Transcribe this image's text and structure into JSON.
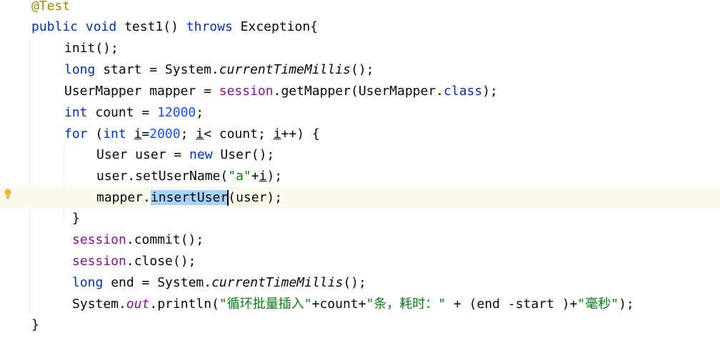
{
  "editor": {
    "lines": [
      [
        {
          "t": "@Test",
          "c": "ann"
        }
      ],
      [
        {
          "t": "public",
          "c": "kw"
        },
        {
          "t": " "
        },
        {
          "t": "void",
          "c": "kw"
        },
        {
          "t": " test1() "
        },
        {
          "t": "throws",
          "c": "kw"
        },
        {
          "t": " Exception{"
        }
      ],
      [
        {
          "t": "init();"
        }
      ],
      [
        {
          "t": "long",
          "c": "kw"
        },
        {
          "t": " start = System."
        },
        {
          "t": "currentTimeMillis",
          "c": "static-m"
        },
        {
          "t": "();"
        }
      ],
      [
        {
          "t": "UserMapper mapper = "
        },
        {
          "t": "session",
          "c": "fld"
        },
        {
          "t": ".getMapper(UserMapper."
        },
        {
          "t": "class",
          "c": "kw"
        },
        {
          "t": ");"
        }
      ],
      [
        {
          "t": "int",
          "c": "kw"
        },
        {
          "t": " count = "
        },
        {
          "t": "12000",
          "c": "num"
        },
        {
          "t": ";"
        }
      ],
      [
        {
          "t": "for",
          "c": "kw"
        },
        {
          "t": " ("
        },
        {
          "t": "int",
          "c": "kw"
        },
        {
          "t": " "
        },
        {
          "t": "i",
          "c": "ul"
        },
        {
          "t": "="
        },
        {
          "t": "2000",
          "c": "num"
        },
        {
          "t": "; "
        },
        {
          "t": "i",
          "c": "ul"
        },
        {
          "t": "< count; "
        },
        {
          "t": "i",
          "c": "ul"
        },
        {
          "t": "++) {"
        }
      ],
      [
        {
          "t": "User user = "
        },
        {
          "t": "new",
          "c": "kw"
        },
        {
          "t": " User();"
        }
      ],
      [
        {
          "t": "user.setUserName("
        },
        {
          "t": "\"a\"",
          "c": "str"
        },
        {
          "t": "+"
        },
        {
          "t": "i",
          "c": "ul"
        },
        {
          "t": ");"
        }
      ],
      [
        {
          "t": "mapper."
        },
        {
          "t": "insertUser",
          "c": "sel"
        },
        {
          "t": "",
          "c": "caret"
        },
        {
          "t": "(user);"
        }
      ],
      [
        {
          "t": "}"
        }
      ],
      [
        {
          "t": "session",
          "c": "fld"
        },
        {
          "t": ".commit();"
        }
      ],
      [
        {
          "t": "session",
          "c": "fld"
        },
        {
          "t": ".close();"
        }
      ],
      [
        {
          "t": "long",
          "c": "kw"
        },
        {
          "t": " end = System."
        },
        {
          "t": "currentTimeMillis",
          "c": "static-m"
        },
        {
          "t": "();"
        }
      ],
      [
        {
          "t": "System."
        },
        {
          "t": "out",
          "c": "static-f"
        },
        {
          "t": ".println("
        },
        {
          "t": "\"循环批量插入\"",
          "c": "str"
        },
        {
          "t": "+count+"
        },
        {
          "t": "\"条，耗时：\"",
          "c": "str"
        },
        {
          "t": " + (end -start )+"
        },
        {
          "t": "\"毫秒\"",
          "c": "str"
        },
        {
          "t": ");"
        }
      ],
      [
        {
          "t": "}"
        }
      ]
    ]
  }
}
